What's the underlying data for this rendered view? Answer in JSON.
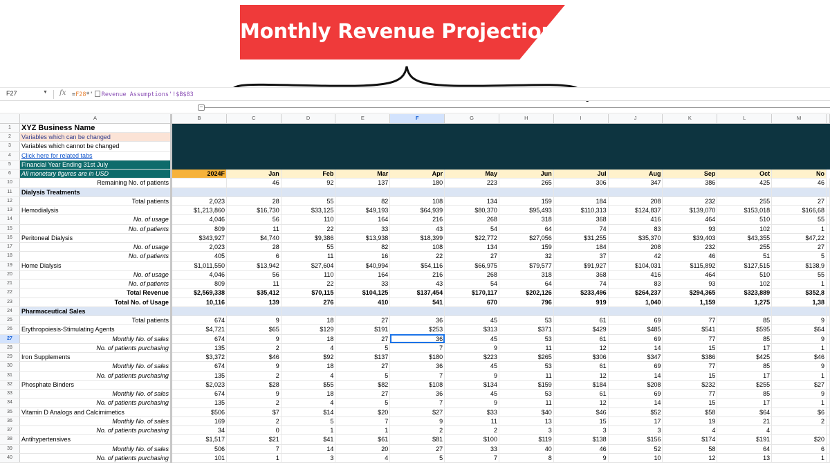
{
  "banner": {
    "title": "Monthly Revenue Projection"
  },
  "formula_bar": {
    "cell_ref": "F27",
    "fx_icon": "fx-icon",
    "formula_eq": "=",
    "formula_ref": "F28",
    "formula_op": "*'",
    "formula_rest": "Revenue Assumptions'!$B$83"
  },
  "group_toggle": "−",
  "columns": [
    "A",
    "B",
    "C",
    "D",
    "E",
    "F",
    "G",
    "H",
    "I",
    "J",
    "K",
    "L",
    "M"
  ],
  "selected_column": "F",
  "selected_row": 27,
  "info_rows": [
    {
      "rn": "1",
      "label": "XYZ Business Name",
      "style": "title"
    },
    {
      "rn": "2",
      "label": "Variables which can be changed",
      "style": "changeable"
    },
    {
      "rn": "3",
      "label": "Variables which cannot be changed",
      "style": "plain"
    },
    {
      "rn": "4",
      "label": "Click here for related tabs",
      "style": "link"
    },
    {
      "rn": "5",
      "label": "Financial Year Ending 31st July",
      "style": "teal"
    }
  ],
  "header_row": {
    "rn": "6",
    "label": "All monetary figures are in USD",
    "cells": [
      "2024F",
      "Jan",
      "Feb",
      "Mar",
      "Apr",
      "May",
      "Jun",
      "Jul",
      "Aug",
      "Sep",
      "Oct",
      "No"
    ]
  },
  "rows": [
    {
      "rn": "10",
      "label": "Remaining No. of patients",
      "align": "right",
      "cells": [
        "",
        "46",
        "92",
        "137",
        "180",
        "223",
        "265",
        "306",
        "347",
        "386",
        "425",
        "46"
      ]
    },
    {
      "rn": "11",
      "label": "Dialysis Treatments",
      "section": true,
      "cells": []
    },
    {
      "rn": "12",
      "label": "Total patients",
      "align": "right",
      "cells": [
        "2,023",
        "28",
        "55",
        "82",
        "108",
        "134",
        "159",
        "184",
        "208",
        "232",
        "255",
        "27"
      ]
    },
    {
      "rn": "13",
      "label": "Hemodialysis",
      "cells": [
        "$1,213,860",
        "$16,730",
        "$33,125",
        "$49,193",
        "$64,939",
        "$80,370",
        "$95,493",
        "$110,313",
        "$124,837",
        "$139,070",
        "$153,018",
        "$166,68"
      ]
    },
    {
      "rn": "14",
      "label": "No. of usage",
      "align": "right",
      "italic": true,
      "cells": [
        "4,046",
        "56",
        "110",
        "164",
        "216",
        "268",
        "318",
        "368",
        "416",
        "464",
        "510",
        "55"
      ]
    },
    {
      "rn": "15",
      "label": "No. of patients",
      "align": "right",
      "italic": true,
      "cells": [
        "809",
        "11",
        "22",
        "33",
        "43",
        "54",
        "64",
        "74",
        "83",
        "93",
        "102",
        "1"
      ]
    },
    {
      "rn": "16",
      "label": "Peritoneal Dialysis",
      "cells": [
        "$343,927",
        "$4,740",
        "$9,386",
        "$13,938",
        "$18,399",
        "$22,772",
        "$27,056",
        "$31,255",
        "$35,370",
        "$39,403",
        "$43,355",
        "$47,22"
      ]
    },
    {
      "rn": "17",
      "label": "No. of usage",
      "align": "right",
      "italic": true,
      "cells": [
        "2,023",
        "28",
        "55",
        "82",
        "108",
        "134",
        "159",
        "184",
        "208",
        "232",
        "255",
        "27"
      ]
    },
    {
      "rn": "18",
      "label": "No. of patients",
      "align": "right",
      "italic": true,
      "cells": [
        "405",
        "6",
        "11",
        "16",
        "22",
        "27",
        "32",
        "37",
        "42",
        "46",
        "51",
        "5"
      ]
    },
    {
      "rn": "19",
      "label": "Home Dialysis",
      "cells": [
        "$1,011,550",
        "$13,942",
        "$27,604",
        "$40,994",
        "$54,116",
        "$66,975",
        "$79,577",
        "$91,927",
        "$104,031",
        "$115,892",
        "$127,515",
        "$138,9"
      ]
    },
    {
      "rn": "20",
      "label": "No. of usage",
      "align": "right",
      "italic": true,
      "cells": [
        "4,046",
        "56",
        "110",
        "164",
        "216",
        "268",
        "318",
        "368",
        "416",
        "464",
        "510",
        "55"
      ]
    },
    {
      "rn": "21",
      "label": "No. of patients",
      "align": "right",
      "italic": true,
      "cells": [
        "809",
        "11",
        "22",
        "33",
        "43",
        "54",
        "64",
        "74",
        "83",
        "93",
        "102",
        "1"
      ]
    },
    {
      "rn": "22",
      "label": "Total Revenue",
      "align": "right",
      "bold": true,
      "cells": [
        "$2,569,338",
        "$35,412",
        "$70,115",
        "$104,125",
        "$137,454",
        "$170,117",
        "$202,126",
        "$233,496",
        "$264,237",
        "$294,365",
        "$323,889",
        "$352,8"
      ]
    },
    {
      "rn": "23",
      "label": "Total No. of Usage",
      "align": "right",
      "bold": true,
      "cells": [
        "10,116",
        "139",
        "276",
        "410",
        "541",
        "670",
        "796",
        "919",
        "1,040",
        "1,159",
        "1,275",
        "1,38"
      ]
    },
    {
      "rn": "24",
      "label": "Pharmaceutical Sales",
      "section": true,
      "cells": []
    },
    {
      "rn": "25",
      "label": "Total patients",
      "align": "right",
      "cells": [
        "674",
        "9",
        "18",
        "27",
        "36",
        "45",
        "53",
        "61",
        "69",
        "77",
        "85",
        "9"
      ]
    },
    {
      "rn": "26",
      "label": "Erythropoiesis-Stimulating Agents",
      "cells": [
        "$4,721",
        "$65",
        "$129",
        "$191",
        "$253",
        "$313",
        "$371",
        "$429",
        "$485",
        "$541",
        "$595",
        "$64"
      ]
    },
    {
      "rn": "27",
      "label": "Monthly No. of sales",
      "align": "right",
      "italic": true,
      "cells": [
        "674",
        "9",
        "18",
        "27",
        "36",
        "45",
        "53",
        "61",
        "69",
        "77",
        "85",
        "9"
      ]
    },
    {
      "rn": "28",
      "label": "No. of patients purchasing",
      "align": "right",
      "italic": true,
      "cells": [
        "135",
        "2",
        "4",
        "5",
        "7",
        "9",
        "11",
        "12",
        "14",
        "15",
        "17",
        "1"
      ]
    },
    {
      "rn": "29",
      "label": "Iron Supplements",
      "cells": [
        "$3,372",
        "$46",
        "$92",
        "$137",
        "$180",
        "$223",
        "$265",
        "$306",
        "$347",
        "$386",
        "$425",
        "$46"
      ]
    },
    {
      "rn": "30",
      "label": "Monthly No. of sales",
      "align": "right",
      "italic": true,
      "cells": [
        "674",
        "9",
        "18",
        "27",
        "36",
        "45",
        "53",
        "61",
        "69",
        "77",
        "85",
        "9"
      ]
    },
    {
      "rn": "31",
      "label": "No. of patients purchasing",
      "align": "right",
      "italic": true,
      "cells": [
        "135",
        "2",
        "4",
        "5",
        "7",
        "9",
        "11",
        "12",
        "14",
        "15",
        "17",
        "1"
      ]
    },
    {
      "rn": "32",
      "label": "Phosphate Binders",
      "cells": [
        "$2,023",
        "$28",
        "$55",
        "$82",
        "$108",
        "$134",
        "$159",
        "$184",
        "$208",
        "$232",
        "$255",
        "$27"
      ]
    },
    {
      "rn": "33",
      "label": "Monthly No. of sales",
      "align": "right",
      "italic": true,
      "cells": [
        "674",
        "9",
        "18",
        "27",
        "36",
        "45",
        "53",
        "61",
        "69",
        "77",
        "85",
        "9"
      ]
    },
    {
      "rn": "34",
      "label": "No. of patients purchasing",
      "align": "right",
      "italic": true,
      "cells": [
        "135",
        "2",
        "4",
        "5",
        "7",
        "9",
        "11",
        "12",
        "14",
        "15",
        "17",
        "1"
      ]
    },
    {
      "rn": "35",
      "label": "Vitamin D Analogs and Calcimimetics",
      "cells": [
        "$506",
        "$7",
        "$14",
        "$20",
        "$27",
        "$33",
        "$40",
        "$46",
        "$52",
        "$58",
        "$64",
        "$6"
      ]
    },
    {
      "rn": "36",
      "label": "Monthly No. of sales",
      "align": "right",
      "italic": true,
      "cells": [
        "169",
        "2",
        "5",
        "7",
        "9",
        "11",
        "13",
        "15",
        "17",
        "19",
        "21",
        "2"
      ]
    },
    {
      "rn": "37",
      "label": "No. of patients purchasing",
      "align": "right",
      "italic": true,
      "cells": [
        "34",
        "0",
        "1",
        "1",
        "2",
        "2",
        "3",
        "3",
        "3",
        "4",
        "4",
        ""
      ]
    },
    {
      "rn": "38",
      "label": "Antihypertensives",
      "cells": [
        "$1,517",
        "$21",
        "$41",
        "$61",
        "$81",
        "$100",
        "$119",
        "$138",
        "$156",
        "$174",
        "$191",
        "$20"
      ]
    },
    {
      "rn": "39",
      "label": "Monthly No. of sales",
      "align": "right",
      "italic": true,
      "cells": [
        "506",
        "7",
        "14",
        "20",
        "27",
        "33",
        "40",
        "46",
        "52",
        "58",
        "64",
        "6"
      ]
    },
    {
      "rn": "40",
      "label": "No. of patients purchasing",
      "align": "right",
      "italic": true,
      "cells": [
        "101",
        "1",
        "3",
        "4",
        "5",
        "7",
        "8",
        "9",
        "10",
        "12",
        "13",
        "1"
      ]
    }
  ]
}
